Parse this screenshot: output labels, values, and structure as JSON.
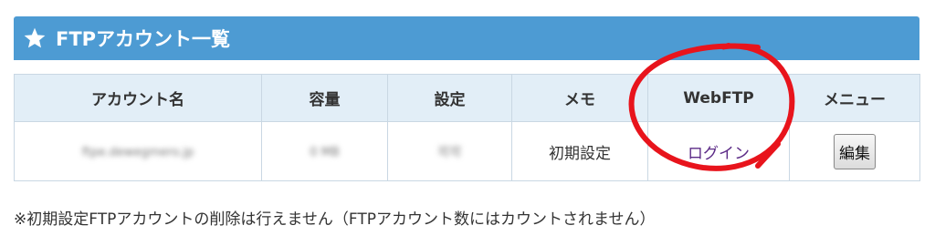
{
  "panel": {
    "title": "FTPアカウント一覧",
    "icon": "star-icon",
    "header_color": "#4d9bd3"
  },
  "table": {
    "headers": [
      "アカウント名",
      "容量",
      "設定",
      "メモ",
      "WebFTP",
      "メニュー"
    ],
    "rows": [
      {
        "account": "ftpe.dewegmero.jp",
        "capacity": "0 MB",
        "setting": "可可",
        "memo": "初期設定",
        "webftp_link": "ログイン",
        "menu_button": "編集"
      }
    ]
  },
  "annotation": {
    "color": "#e8141c",
    "shape": "hand-drawn-circle"
  },
  "note": "※初期設定FTPアカウントの削除は行えません（FTPアカウント数にはカウントされません）"
}
